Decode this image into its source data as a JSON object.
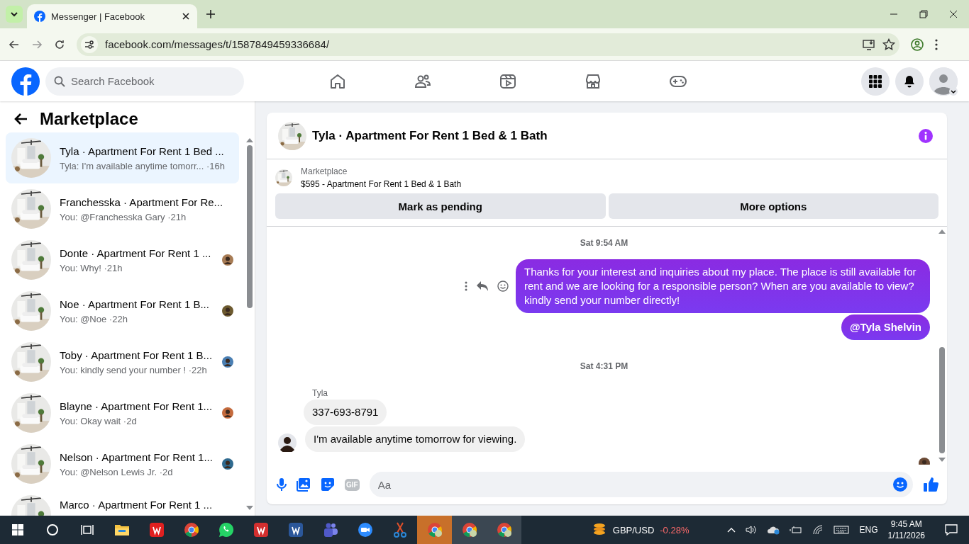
{
  "browser": {
    "tab_title": "Messenger | Facebook",
    "url": "facebook.com/messages/t/1587849459336684/"
  },
  "facebook": {
    "search_placeholder": "Search Facebook"
  },
  "sidebar": {
    "title": "Marketplace",
    "conversations": [
      {
        "title": "Tyla · Apartment For Rent 1 Bed ...",
        "preview": "Tyla: I'm available anytime tomorr...",
        "time": "·16h",
        "selected": true,
        "seen": false
      },
      {
        "title": "Franchesska · Apartment For Re...",
        "preview": "You: @Franchesska Gary",
        "time": "·21h",
        "selected": false,
        "seen": false
      },
      {
        "title": "Donte · Apartment For Rent 1 ...",
        "preview": "You: Why!",
        "time": "·21h",
        "selected": false,
        "seen": true
      },
      {
        "title": "Noe · Apartment For Rent 1 B...",
        "preview": "You: @Noe",
        "time": "·22h",
        "selected": false,
        "seen": true
      },
      {
        "title": "Toby · Apartment For Rent 1 B...",
        "preview": "You: kindly send your number !",
        "time": "·22h",
        "selected": false,
        "seen": true
      },
      {
        "title": "Blayne · Apartment For Rent 1...",
        "preview": "You: Okay wait",
        "time": "·2d",
        "selected": false,
        "seen": true
      },
      {
        "title": "Nelson · Apartment For Rent 1...",
        "preview": "You: @Nelson Lewis Jr.",
        "time": "·2d",
        "selected": false,
        "seen": true
      },
      {
        "title": "Marco · Apartment For Rent 1 ...",
        "selected": false,
        "seen": false
      }
    ]
  },
  "chat": {
    "title": "Tyla · Apartment For Rent 1 Bed & 1 Bath",
    "listing_label": "Marketplace",
    "listing_title": "$595 - Apartment For Rent 1 Bed & 1 Bath",
    "buttons": [
      "Mark as pending",
      "More options"
    ],
    "messages": [
      {
        "kind": "time",
        "text": "Sat 9:54 AM"
      },
      {
        "kind": "out",
        "text": "Thanks for your interest and inquiries about my place. The place is still available for rent and we are looking for a responsible person? When are you available to view? kindly send your number directly!"
      },
      {
        "kind": "out",
        "text": "@Tyla Shelvin"
      },
      {
        "kind": "time",
        "text": "Sat 4:31 PM"
      },
      {
        "kind": "sender",
        "text": "Tyla"
      },
      {
        "kind": "in",
        "text": "337-693-8791"
      },
      {
        "kind": "in_last",
        "text": "I'm available anytime tomorrow for viewing."
      }
    ],
    "composer_placeholder": "Aa",
    "gif_label": "GIF"
  },
  "taskbar": {
    "ticker": "GBP/USD",
    "change": "-0.28%",
    "language": "ENG",
    "time": "9:45 AM",
    "date": "1/11/2026"
  }
}
